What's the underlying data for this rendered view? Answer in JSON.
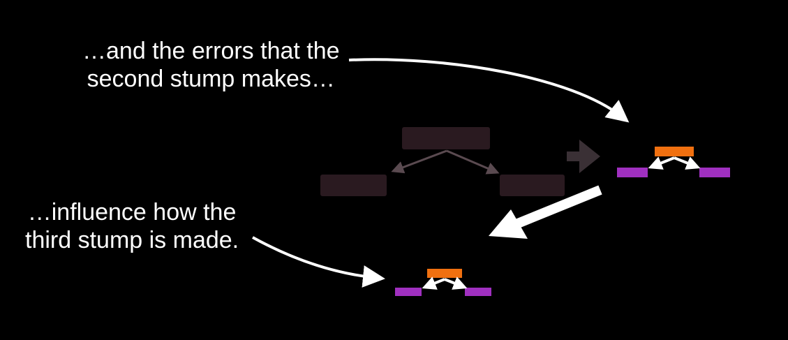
{
  "captions": {
    "top": {
      "line1": "…and the errors that the",
      "line2": "second stump makes…"
    },
    "bottom": {
      "line1": "…influence how the",
      "line2": "third stump is made."
    }
  },
  "colors": {
    "background": "#000000",
    "faded_node": "#2a1a20",
    "faded_arrow": "#5a4a50",
    "stump_root": "#f07010",
    "stump_leaf": "#a030c0",
    "arrow": "#ffffff",
    "transition_arrow": "#3a3035"
  },
  "icons": {
    "faded_tree": "tree-diagram-icon",
    "stump": "stump-icon",
    "curved_arrow": "curved-arrow-icon",
    "straight_arrow": "arrow-icon"
  }
}
